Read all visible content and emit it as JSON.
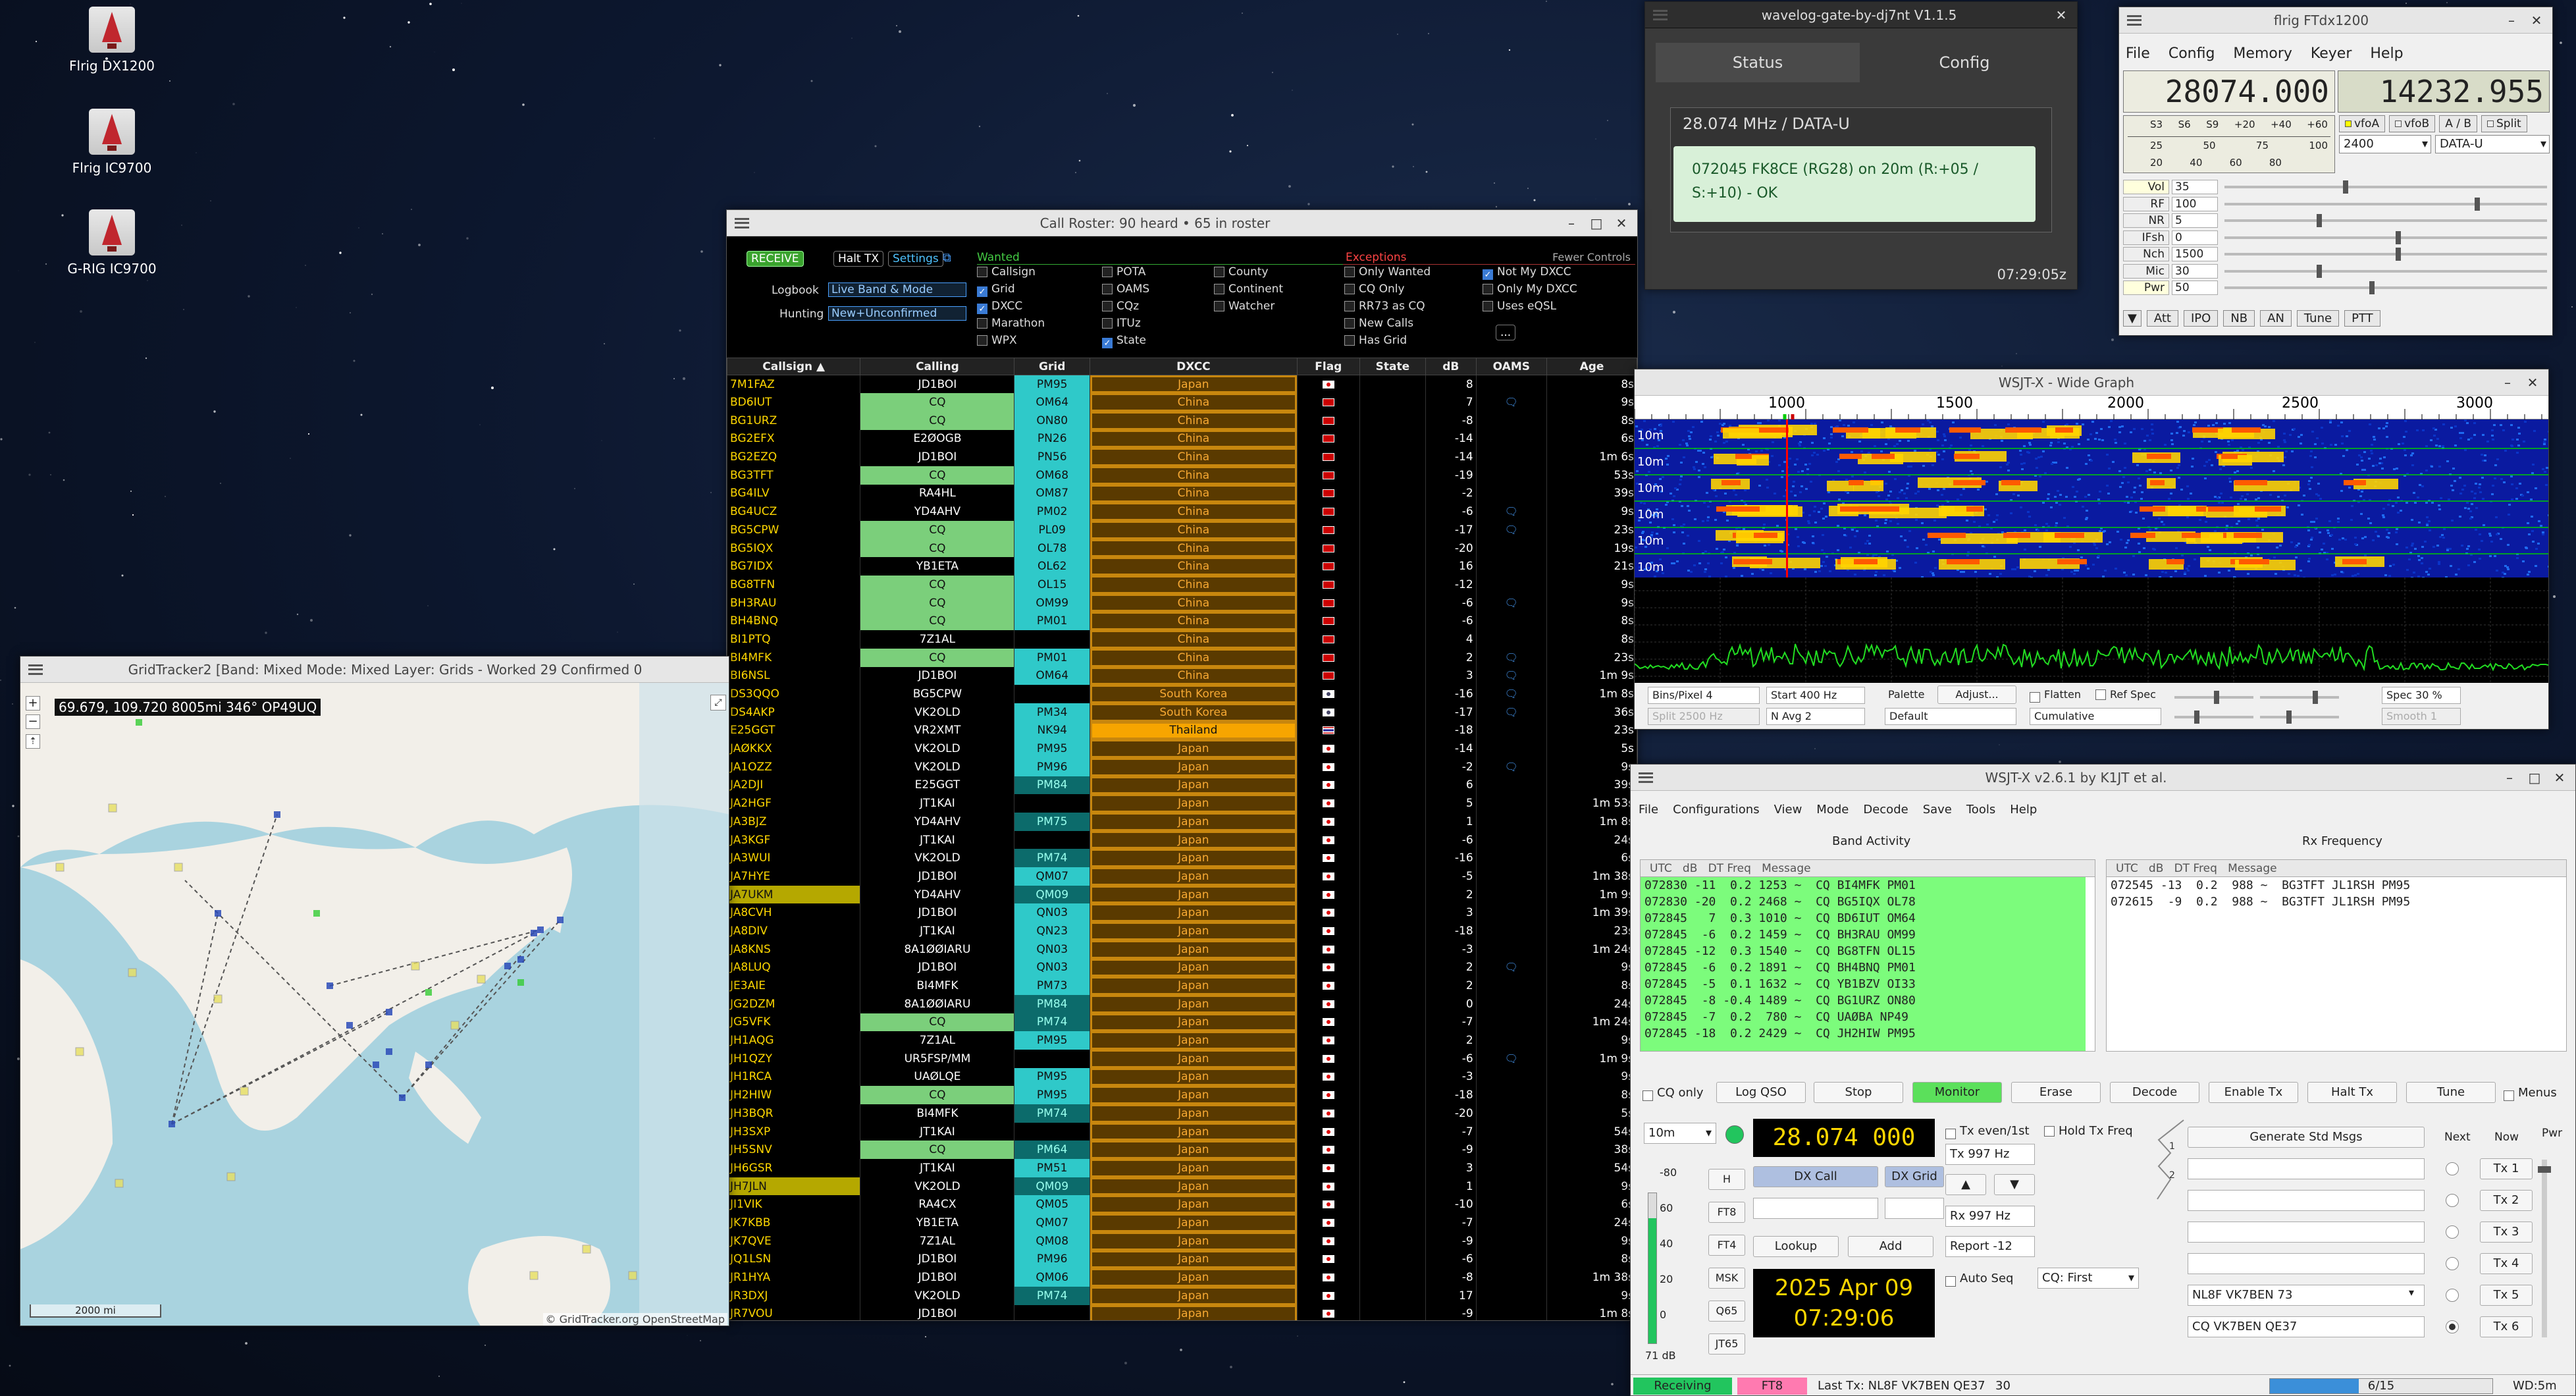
{
  "desktop": {
    "icons": [
      {
        "label": "Flrig DX1200"
      },
      {
        "label": "Flrig IC9700"
      },
      {
        "label": "G-RIG IC9700"
      }
    ]
  },
  "wavelog": {
    "title": "wavelog-gate-by-dj7nt V1.1.5",
    "tabs": [
      "Status",
      "Config"
    ],
    "freq": "28.074 MHz / DATA-U",
    "message": "072045 FK8CE (RG28) on 20m (R:+05 / S:+10) - OK",
    "time": "07:29:05z"
  },
  "flrig": {
    "title": "flrig FTdx1200",
    "menu": [
      "File",
      "Config",
      "Memory",
      "Keyer",
      "Help"
    ],
    "vfoA": "28074.000",
    "vfoB": "14232.955",
    "smeter": [
      "S3",
      "S6",
      "S9",
      "+20",
      "+40",
      "+60"
    ],
    "pwr_scale": [
      "25",
      "50",
      "75",
      "100"
    ],
    "pwr_scale2": [
      "20",
      "40",
      "60",
      "80"
    ],
    "buttons": [
      "vfoA",
      "vfoB",
      "A / B",
      "Split"
    ],
    "bw": "2400",
    "mode": "DATA-U",
    "sliders": [
      {
        "label": "Vol",
        "value": "35"
      },
      {
        "label": "RF",
        "value": "100"
      },
      {
        "label": "NR",
        "value": "5"
      },
      {
        "label": "IFsh",
        "value": "0"
      },
      {
        "label": "Nch",
        "value": "1500"
      },
      {
        "label": "Mic",
        "value": "30"
      },
      {
        "label": "Pwr",
        "value": "50"
      }
    ],
    "bottom": [
      "Att",
      "IPO",
      "NB",
      "AN",
      "Tune",
      "PTT"
    ]
  },
  "roster": {
    "title": "Call Roster: 90 heard • 65 in roster",
    "receive": "RECEIVE",
    "halt": "Halt TX",
    "settings": "Settings",
    "wanted": "Wanted",
    "exceptions": "Exceptions",
    "fewer": "Fewer Controls",
    "logbook_label": "Logbook",
    "logbook_value": "Live Band & Mode",
    "hunting_label": "Hunting",
    "hunting_value": "New+Unconfirmed",
    "wanted_items": [
      {
        "t": "Callsign",
        "on": false
      },
      {
        "t": "Grid",
        "on": true
      },
      {
        "t": "DXCC",
        "on": true
      },
      {
        "t": "Marathon",
        "on": false
      },
      {
        "t": "WPX",
        "on": false
      },
      {
        "t": "POTA",
        "on": false
      },
      {
        "t": "OAMS",
        "on": false
      },
      {
        "t": "CQz",
        "on": false
      },
      {
        "t": "ITUz",
        "on": false
      },
      {
        "t": "State",
        "on": true
      },
      {
        "t": "County",
        "on": false
      },
      {
        "t": "Continent",
        "on": false
      },
      {
        "t": "Watcher",
        "on": false
      }
    ],
    "exc_items": [
      {
        "t": "Only Wanted",
        "on": false
      },
      {
        "t": "CQ Only",
        "on": false
      },
      {
        "t": "RR73 as CQ",
        "on": false
      },
      {
        "t": "New Calls",
        "on": false
      },
      {
        "t": "Has Grid",
        "on": false
      },
      {
        "t": "Not My DXCC",
        "on": true
      },
      {
        "t": "Only My DXCC",
        "on": false
      },
      {
        "t": "Uses eQSL",
        "on": false
      }
    ],
    "more": "...",
    "columns": [
      "Callsign ▲",
      "Calling",
      "Grid",
      "DXCC",
      "Flag",
      "State",
      "dB",
      "OAMS",
      "Age"
    ],
    "rows": [
      [
        "7M1FAZ",
        "JD1BOI",
        "PM95",
        "Japan",
        "jp",
        "",
        "8",
        "",
        "8s"
      ],
      [
        "BD6IUT",
        "CQ",
        "OM64",
        "China",
        "cn",
        "",
        "7",
        "1",
        "9s"
      ],
      [
        "BG1URZ",
        "CQ",
        "ON80",
        "China",
        "cn",
        "",
        "-8",
        "",
        "8s"
      ],
      [
        "BG2EFX",
        "E2ØOGB",
        "PN26",
        "China",
        "cn",
        "",
        "-14",
        "",
        "6s"
      ],
      [
        "BG2EZQ",
        "JD1BOI",
        "PN56",
        "China",
        "cn",
        "",
        "-14",
        "",
        "1m 6s"
      ],
      [
        "BG3TFT",
        "CQ",
        "OM68",
        "China",
        "cn",
        "",
        "-19",
        "",
        "53s"
      ],
      [
        "BG4ILV",
        "RA4HL",
        "OM87",
        "China",
        "cn",
        "",
        "-2",
        "",
        "39s"
      ],
      [
        "BG4UCZ",
        "YD4AHV",
        "PM02",
        "China",
        "cn",
        "",
        "-6",
        "1",
        "9s"
      ],
      [
        "BG5CPW",
        "CQ",
        "PL09",
        "China",
        "cn",
        "",
        "-17",
        "1",
        "23s"
      ],
      [
        "BG5IQX",
        "CQ",
        "OL78",
        "China",
        "cn",
        "",
        "-20",
        "",
        "19s"
      ],
      [
        "BG7IDX",
        "YB1ETA",
        "OL62",
        "China",
        "cn",
        "",
        "16",
        "",
        "21s"
      ],
      [
        "BG8TFN",
        "CQ",
        "OL15",
        "China",
        "cn",
        "",
        "-12",
        "",
        "9s"
      ],
      [
        "BH3RAU",
        "CQ",
        "OM99",
        "China",
        "cn",
        "",
        "-6",
        "1",
        "9s"
      ],
      [
        "BH4BNQ",
        "CQ",
        "PM01",
        "China",
        "cn",
        "",
        "-6",
        "",
        "8s"
      ],
      [
        "BI1PTQ",
        "7Z1AL",
        "",
        "China",
        "cn",
        "",
        "4",
        "",
        "8s"
      ],
      [
        "BI4MFK",
        "CQ",
        "PM01",
        "China",
        "cn",
        "",
        "2",
        "1",
        "23s"
      ],
      [
        "BI6NSL",
        "JD1BOI",
        "OM64",
        "China",
        "cn",
        "",
        "3",
        "1",
        "1m 9s"
      ],
      [
        "DS3QQO",
        "BG5CPW",
        "",
        "South Korea",
        "kr",
        "",
        "-16",
        "1",
        "1m 8s"
      ],
      [
        "DS4AKP",
        "VK2OLD",
        "PM34",
        "South Korea",
        "kr",
        "",
        "-17",
        "1",
        "36s"
      ],
      [
        "E25GGT",
        "VR2XMT",
        "NK94",
        "Thailand",
        "th",
        "",
        "-18",
        "",
        "23s"
      ],
      [
        "JAØKKX",
        "VK2OLD",
        "PM95",
        "Japan",
        "jp",
        "",
        "-14",
        "",
        "5s"
      ],
      [
        "JA1OZZ",
        "VK2OLD",
        "PM96",
        "Japan",
        "jp",
        "",
        "-2",
        "1",
        "9s"
      ],
      [
        "JA2DJI",
        "E25GGT",
        "PM84",
        "Japan",
        "jp",
        "",
        "6",
        "",
        "39s"
      ],
      [
        "JA2HGF",
        "JT1KAI",
        "",
        "Japan",
        "jp",
        "",
        "5",
        "",
        "1m 53s"
      ],
      [
        "JA3BJZ",
        "YD4AHV",
        "PM75",
        "Japan",
        "jp",
        "",
        "1",
        "",
        "1m 8s"
      ],
      [
        "JA3KGF",
        "JT1KAI",
        "",
        "Japan",
        "jp",
        "",
        "-6",
        "",
        "24s"
      ],
      [
        "JA3WUI",
        "VK2OLD",
        "PM74",
        "Japan",
        "jp",
        "",
        "-16",
        "",
        "6s"
      ],
      [
        "JA7HYE",
        "JD1BOI",
        "QM07",
        "Japan",
        "jp",
        "",
        "-5",
        "",
        "1m 38s"
      ],
      [
        "JA7UKM",
        "YD4AHV",
        "QM09",
        "Japan",
        "jp",
        "",
        "2",
        "",
        "1m 9s"
      ],
      [
        "JA8CVH",
        "JD1BOI",
        "QN03",
        "Japan",
        "jp",
        "",
        "3",
        "",
        "1m 39s"
      ],
      [
        "JA8DIV",
        "JT1KAI",
        "QN23",
        "Japan",
        "jp",
        "",
        "-18",
        "",
        "23s"
      ],
      [
        "JA8KNS",
        "8A1ØØIARU",
        "QN03",
        "Japan",
        "jp",
        "",
        "-3",
        "",
        "1m 24s"
      ],
      [
        "JA8LUQ",
        "JD1BOI",
        "QN03",
        "Japan",
        "jp",
        "",
        "2",
        "1",
        "9s"
      ],
      [
        "JE3AIE",
        "BI4MFK",
        "PM73",
        "Japan",
        "jp",
        "",
        "2",
        "",
        "8s"
      ],
      [
        "JG2DZM",
        "8A1ØØIARU",
        "PM84",
        "Japan",
        "jp",
        "",
        "0",
        "",
        "24s"
      ],
      [
        "JG5VFK",
        "CQ",
        "PM74",
        "Japan",
        "jp",
        "",
        "-7",
        "",
        "1m 24s"
      ],
      [
        "JH1AQG",
        "7Z1AL",
        "PM95",
        "Japan",
        "jp",
        "",
        "2",
        "",
        "9s"
      ],
      [
        "JH1QZY",
        "UR5FSP/MM",
        "",
        "Japan",
        "jp",
        "",
        "-6",
        "1",
        "1m 9s"
      ],
      [
        "JH1RCA",
        "UAØLQE",
        "PM95",
        "Japan",
        "jp",
        "",
        "-3",
        "",
        "9s"
      ],
      [
        "JH2HIW",
        "CQ",
        "PM95",
        "Japan",
        "jp",
        "",
        "-18",
        "",
        "8s"
      ],
      [
        "JH3BQR",
        "BI4MFK",
        "PM74",
        "Japan",
        "jp",
        "",
        "-20",
        "",
        "5s"
      ],
      [
        "JH3SXP",
        "JT1KAI",
        "",
        "Japan",
        "jp",
        "",
        "-7",
        "",
        "54s"
      ],
      [
        "JH5SNV",
        "CQ",
        "PM64",
        "Japan",
        "jp",
        "",
        "-9",
        "",
        "38s"
      ],
      [
        "JH6GSR",
        "JT1KAI",
        "PM51",
        "Japan",
        "jp",
        "",
        "3",
        "",
        "54s"
      ],
      [
        "JH7JLN",
        "VK2OLD",
        "QM09",
        "Japan",
        "jp",
        "",
        "1",
        "",
        "9s"
      ],
      [
        "JI1VIK",
        "RA4CX",
        "QM05",
        "Japan",
        "jp",
        "",
        "-10",
        "",
        "6s"
      ],
      [
        "JK7KBB",
        "YB1ETA",
        "QM07",
        "Japan",
        "jp",
        "",
        "-7",
        "",
        "24s"
      ],
      [
        "JK7QVE",
        "7Z1AL",
        "QM08",
        "Japan",
        "jp",
        "",
        "-9",
        "",
        "9s"
      ],
      [
        "JQ1LSN",
        "JD1BOI",
        "PM96",
        "Japan",
        "jp",
        "",
        "-6",
        "",
        "8s"
      ],
      [
        "JR1HYA",
        "JD1BOI",
        "QM06",
        "Japan",
        "jp",
        "",
        "-8",
        "",
        "1m 38s"
      ],
      [
        "JR3DXJ",
        "VK2OLD",
        "PM74",
        "Japan",
        "jp",
        "",
        "17",
        "",
        "9s"
      ],
      [
        "JR7VOU",
        "JD1BOI",
        "",
        "Japan",
        "jp",
        "",
        "-9",
        "",
        "1m 8s"
      ]
    ]
  },
  "gridtracker": {
    "title": "GridTracker2 [Band: Mixed Mode: Mixed Layer: Grids - Worked 29 Confirmed 0",
    "coords": "69.679, 109.720 8005mi 346° OP49UQ",
    "scale": "2000 mi",
    "credit": "© GridTracker.org OpenStreetMap"
  },
  "widegraph": {
    "title": "WSJT-X - Wide Graph",
    "freq_labels": [
      "1000",
      "1500",
      "2000",
      "2500",
      "3000"
    ],
    "band_label": "10m",
    "bins_label": "Bins/Pixel",
    "bins": "4",
    "start": "Start 400 Hz",
    "split": "Split 2500 Hz",
    "navg": "N Avg 2",
    "palette": "Palette",
    "adjust": "Adjust...",
    "default": "Default",
    "flatten": "Flatten",
    "refspec": "Ref Spec",
    "cumulative": "Cumulative",
    "spec": "Spec 30 %",
    "smooth": "Smooth 1"
  },
  "wsjtx": {
    "title": "WSJT-X   v2.6.1   by K1JT et al.",
    "menu": [
      "File",
      "Configurations",
      "View",
      "Mode",
      "Decode",
      "Save",
      "Tools",
      "Help"
    ],
    "band_activity": "Band Activity",
    "rx_freq": "Rx Frequency",
    "hdr": "UTC   dB   DT Freq   Message",
    "band_lines": [
      "072830 -11  0.2 1253 ~  CQ BI4MFK PM01",
      "072830 -20  0.2 2468 ~  CQ BG5IQX OL78",
      "072845   7  0.3 1010 ~  CQ BD6IUT OM64",
      "072845  -6  0.2 1459 ~  CQ BH3RAU OM99",
      "072845 -12  0.3 1540 ~  CQ BG8TFN OL15",
      "072845  -6  0.2 1891 ~  CQ BH4BNQ PM01",
      "072845  -5  0.1 1632 ~  CQ YB1BZV OI33",
      "072845  -8 -0.4 1489 ~  CQ BG1URZ ON80",
      "072845  -7  0.2  780 ~  CQ UAØBA NP49",
      "072845 -18  0.2 2429 ~  CQ JH2HIW PM95"
    ],
    "rx_lines": [
      "072545 -13  0.2  988 ~  BG3TFT JL1RSH PM95",
      "072615  -9  0.2  988 ~  BG3TFT JL1RSH PM95"
    ],
    "cq_only": "CQ only",
    "buttons": [
      "Log QSO",
      "Stop",
      "Monitor",
      "Erase",
      "Decode",
      "Enable Tx",
      "Halt Tx",
      "Tune"
    ],
    "menus": "Menus",
    "band": "10m",
    "dial": "28.074 000",
    "tx_even": "Tx even/1st",
    "hold_tx": "Hold Tx Freq",
    "tx_hz": "Tx  997 Hz",
    "rx_hz": "Rx  997 Hz",
    "report": "Report -12",
    "auto_seq": "Auto Seq",
    "cq_first": "CQ: First",
    "modes": [
      "H",
      "FT8",
      "FT4",
      "MSK",
      "Q65",
      "JT65"
    ],
    "dx_call": "DX Call",
    "dx_grid": "DX Grid",
    "lookup": "Lookup",
    "add": "Add",
    "date": "2025 Apr 09",
    "time": "07:29:06",
    "db": "71 dB",
    "meter": [
      "-80",
      "60",
      "40",
      "20",
      "0"
    ],
    "gen_std": "Generate Std Msgs",
    "next": "Next",
    "now": "Now",
    "pwr": "Pwr",
    "tx_labels": [
      "Tx 1",
      "Tx 2",
      "Tx 3",
      "Tx 4",
      "Tx 5",
      "Tx 6"
    ],
    "tx5": "NL8F VK7BEN 73",
    "tx6": "CQ VK7BEN QE37",
    "status": {
      "receiving": "Receiving",
      "mode": "FT8",
      "last_tx": "Last Tx: NL8F VK7BEN QE37",
      "num": "30",
      "progress": "6/15",
      "wd": "WD:5m"
    }
  },
  "colors": {
    "green": "#7cfc7c",
    "receiving": "#22c55e",
    "ft8": "#ff7ab0",
    "progress": "#3b8fd9",
    "orange": "#f7a933"
  }
}
